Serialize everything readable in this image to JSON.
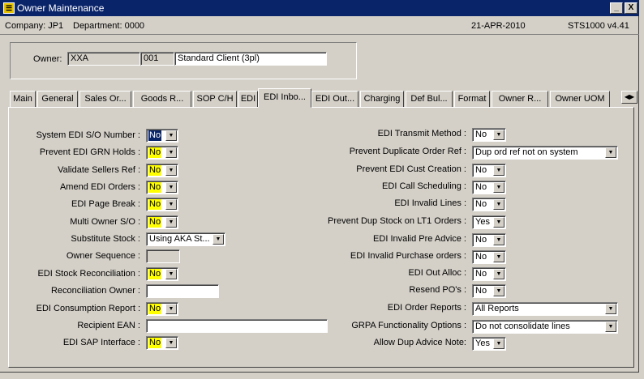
{
  "window": {
    "title": "Owner Maintenance",
    "min_label": "_",
    "close_label": "X"
  },
  "info": {
    "company": "Company:  JP1",
    "department": "Department:  0000",
    "date": "21-APR-2010",
    "version": "STS1000  v4.41"
  },
  "owner": {
    "label": "Owner:",
    "code": "XXA",
    "number": "001",
    "name": "Standard Client (3pl)"
  },
  "tabs": [
    "Main",
    "General",
    "Sales Or...",
    "Goods R...",
    "SOP C/H",
    "EDI",
    "EDI Inbo...",
    "EDI Out...",
    "Charging",
    "Def Bul...",
    "Format",
    "Owner R...",
    "Owner UOM"
  ],
  "tab_arrows": "◀▶",
  "left": {
    "sys_edi_so": {
      "label": "System EDI S/O Number :",
      "value": "No"
    },
    "prev_grn": {
      "label": "Prevent EDI GRN Holds :",
      "value": "No"
    },
    "val_sellers": {
      "label": "Validate Sellers Ref :",
      "value": "No"
    },
    "amend_edi": {
      "label": "Amend EDI Orders :",
      "value": "No"
    },
    "page_break": {
      "label": "EDI Page Break :",
      "value": "No"
    },
    "multi_owner": {
      "label": "Multi Owner S/O :",
      "value": "No"
    },
    "subst_stock": {
      "label": "Substitute Stock :",
      "value": "Using AKA St..."
    },
    "owner_seq": {
      "label": "Owner Sequence :",
      "value": ""
    },
    "stock_recon": {
      "label": "EDI Stock Reconciliation :",
      "value": "No"
    },
    "recon_owner": {
      "label": "Reconciliation Owner :",
      "value": ""
    },
    "consumption": {
      "label": "EDI Consumption Report :",
      "value": "No"
    },
    "recipient_ean": {
      "label": "Recipient EAN :",
      "value": ""
    },
    "sap_iface": {
      "label": "EDI SAP Interface :",
      "value": "No"
    }
  },
  "right": {
    "transmit": {
      "label": "EDI Transmit Method :",
      "value": "No"
    },
    "dup_order": {
      "label": "Prevent Duplicate Order Ref :",
      "value": "Dup ord ref not on system"
    },
    "cust_creation": {
      "label": "Prevent EDI Cust Creation :",
      "value": "No"
    },
    "call_sched": {
      "label": "EDI Call Scheduling :",
      "value": "No"
    },
    "invalid_lines": {
      "label": "EDI Invalid Lines :",
      "value": "No"
    },
    "dup_stock": {
      "label": "Prevent Dup Stock on LT1 Orders :",
      "value": "Yes"
    },
    "invalid_pre": {
      "label": "EDI Invalid Pre Advice :",
      "value": "No"
    },
    "invalid_po": {
      "label": "EDI Invalid Purchase orders :",
      "value": "No"
    },
    "out_alloc": {
      "label": "EDI Out Alloc :",
      "value": "No"
    },
    "resend_po": {
      "label": "Resend PO's :",
      "value": "No"
    },
    "order_reports": {
      "label": "EDI Order Reports :",
      "value": "All Reports"
    },
    "grpa": {
      "label": "GRPA Functionality Options :",
      "value": "Do not consolidate lines"
    },
    "dup_advice": {
      "label": "Allow Dup Advice Note:",
      "value": "Yes"
    }
  },
  "colors": {
    "title_bg": "#0a246a",
    "required": "#ffff00",
    "face": "#d4d0c8"
  },
  "icons": {
    "app": "app-icon",
    "dropdown": "chevron-down-icon",
    "tab_scroll": "tab-scroll-arrows-icon"
  }
}
